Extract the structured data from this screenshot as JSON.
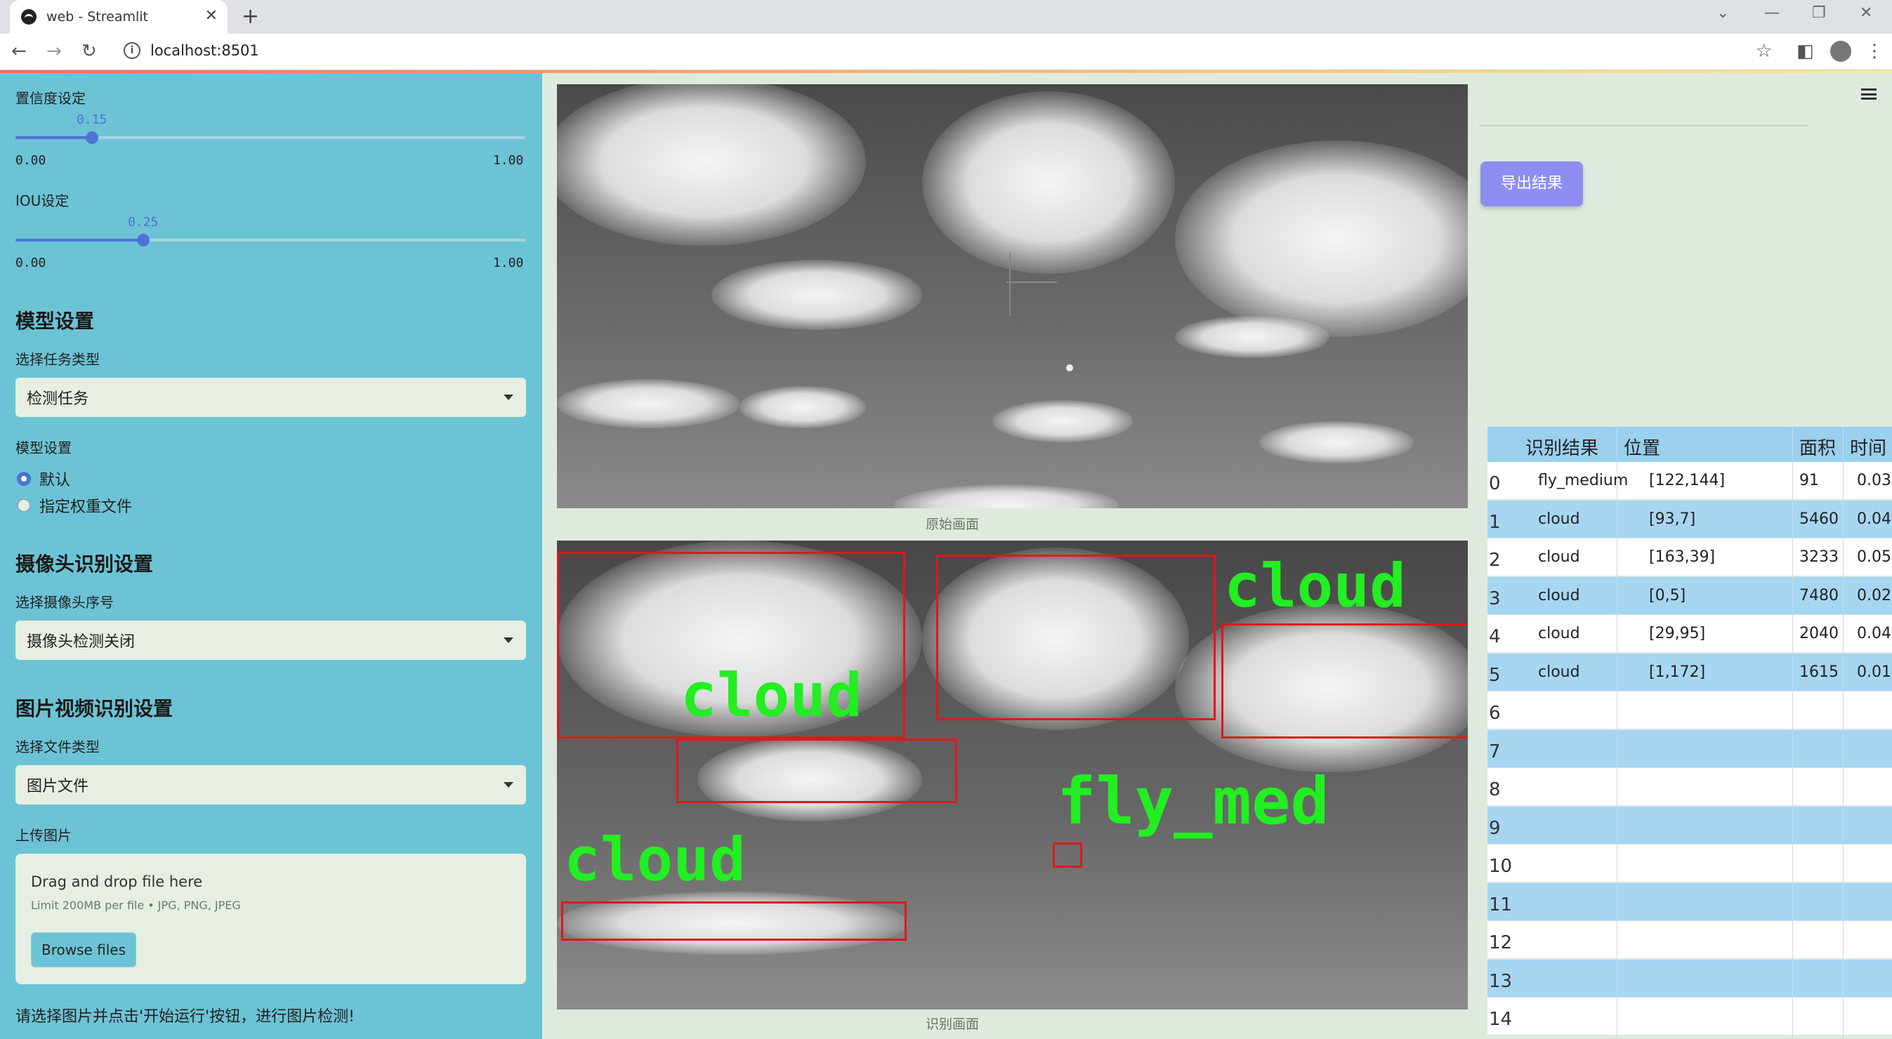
{
  "browser": {
    "tab_title": "web - Streamlit",
    "tab_close": "✕",
    "new_tab": "+",
    "url": "localhost:8501",
    "info_glyph": "i",
    "back": "←",
    "forward": "→",
    "reload": "↻",
    "bookmark": "☆",
    "sidepanel": "◧",
    "more": "⋮",
    "chevron": "⌄",
    "minimize": "—",
    "restore": "❐",
    "close": "✕"
  },
  "sidebar": {
    "confidence_label": "置信度设定",
    "confidence_value": "0.15",
    "confidence_fraction": 0.15,
    "confidence_min": "0.00",
    "confidence_max": "1.00",
    "iou_label": "IOU设定",
    "iou_value": "0.25",
    "iou_fraction": 0.25,
    "iou_min": "0.00",
    "iou_max": "1.00",
    "model_section": "模型设置",
    "task_type_label": "选择任务类型",
    "task_type_value": "检测任务",
    "model_config_label": "模型设置",
    "radio_default": "默认",
    "radio_custom": "指定权重文件",
    "camera_section": "摄像头识别设置",
    "camera_index_label": "选择摄像头序号",
    "camera_value": "摄像头检测关闭",
    "media_section": "图片视频识别设置",
    "file_type_label": "选择文件类型",
    "file_type_value": "图片文件",
    "upload_label": "上传图片",
    "upload_drag": "Drag and drop file here",
    "upload_limit": "Limit 200MB per file • JPG, PNG, JPEG",
    "browse_button": "Browse files",
    "hint": "请选择图片并点击'开始运行'按钮，进行图片检测!"
  },
  "main": {
    "original_caption": "原始画面",
    "result_caption": "识别画面",
    "detection_labels": [
      "cloud",
      "cloud",
      "cloud",
      "fly_med"
    ]
  },
  "right": {
    "export_button": "导出结果",
    "table": {
      "headers": [
        "识别结果",
        "位置",
        "面积",
        "时间"
      ],
      "rows": [
        {
          "idx": "0",
          "result": "fly_medium",
          "pos": "[122,144]",
          "area": "91",
          "time": "0.03"
        },
        {
          "idx": "1",
          "result": "cloud",
          "pos": "[93,7]",
          "area": "5460",
          "time": "0.04"
        },
        {
          "idx": "2",
          "result": "cloud",
          "pos": "[163,39]",
          "area": "3233",
          "time": "0.05"
        },
        {
          "idx": "3",
          "result": "cloud",
          "pos": "[0,5]",
          "area": "7480",
          "time": "0.02"
        },
        {
          "idx": "4",
          "result": "cloud",
          "pos": "[29,95]",
          "area": "2040",
          "time": "0.04"
        },
        {
          "idx": "5",
          "result": "cloud",
          "pos": "[1,172]",
          "area": "1615",
          "time": "0.01"
        },
        {
          "idx": "6",
          "result": "",
          "pos": "",
          "area": "",
          "time": ""
        },
        {
          "idx": "7",
          "result": "",
          "pos": "",
          "area": "",
          "time": ""
        },
        {
          "idx": "8",
          "result": "",
          "pos": "",
          "area": "",
          "time": ""
        },
        {
          "idx": "9",
          "result": "",
          "pos": "",
          "area": "",
          "time": ""
        },
        {
          "idx": "10",
          "result": "",
          "pos": "",
          "area": "",
          "time": ""
        },
        {
          "idx": "11",
          "result": "",
          "pos": "",
          "area": "",
          "time": ""
        },
        {
          "idx": "12",
          "result": "",
          "pos": "",
          "area": "",
          "time": ""
        },
        {
          "idx": "13",
          "result": "",
          "pos": "",
          "area": "",
          "time": ""
        },
        {
          "idx": "14",
          "result": "",
          "pos": "",
          "area": "",
          "time": ""
        }
      ]
    }
  },
  "colors": {
    "sidebar_bg": "#6cc3d5",
    "accent": "#4b74d4",
    "export_btn": "#8e8ef2",
    "box": "#e01818",
    "label_text": "#22ee22"
  }
}
